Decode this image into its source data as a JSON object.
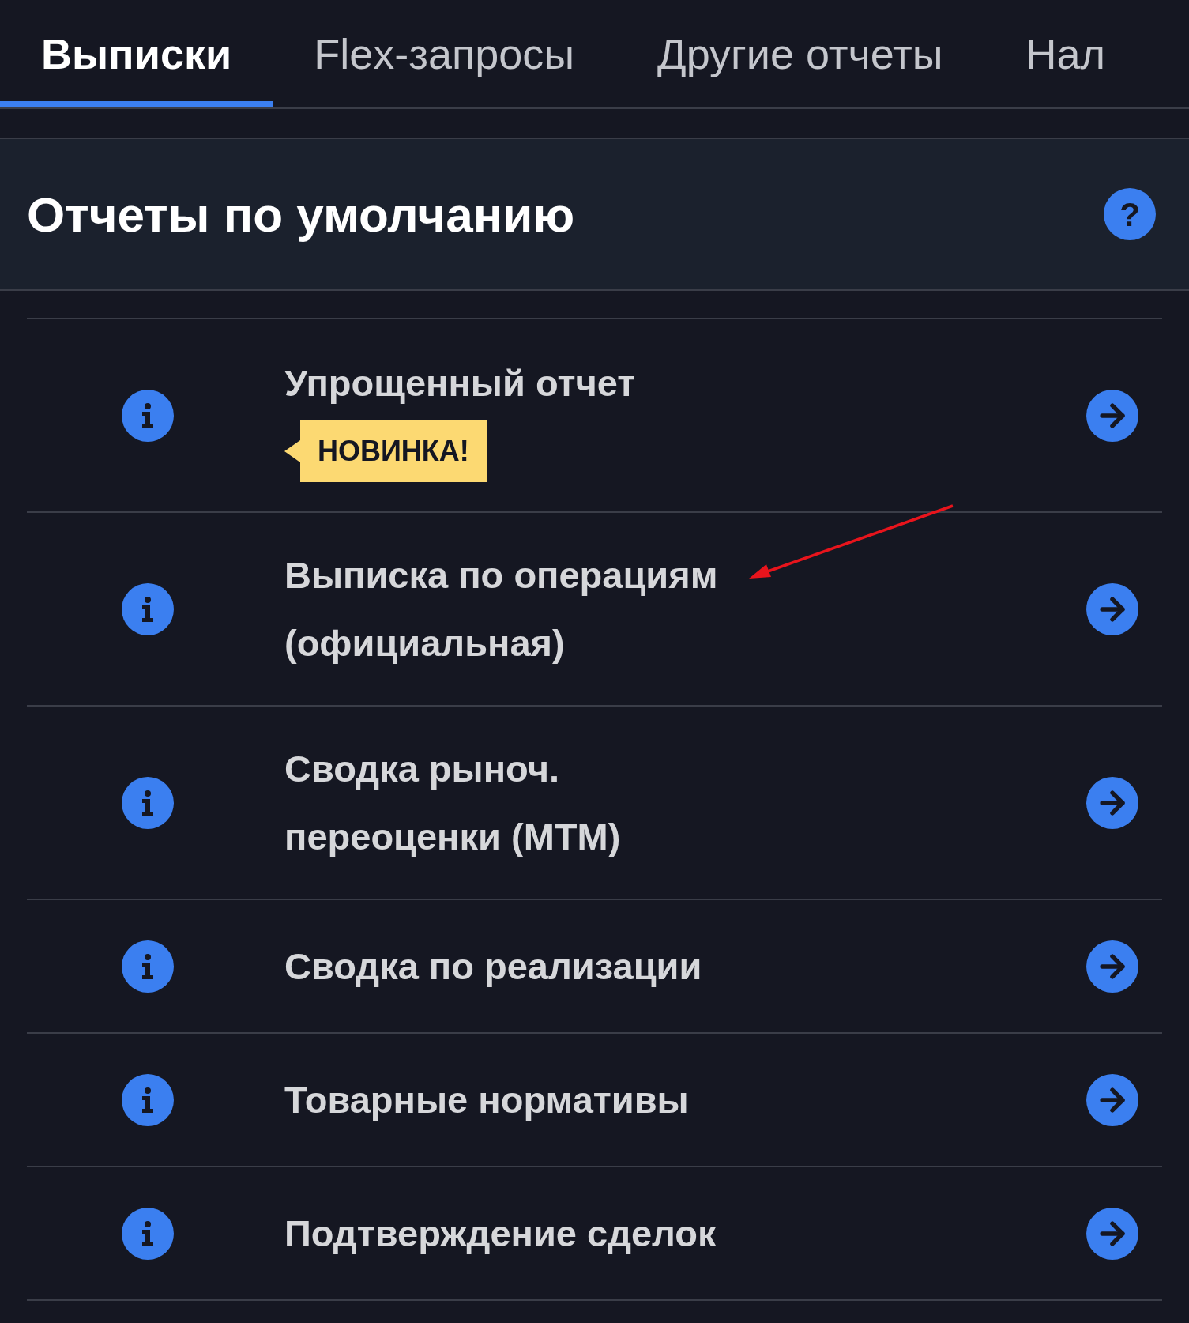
{
  "tabs": [
    {
      "label": "Выписки",
      "selected": true
    },
    {
      "label": "Flex-запросы",
      "selected": false
    },
    {
      "label": "Другие отчеты",
      "selected": false
    },
    {
      "label": "Нал",
      "selected": false
    }
  ],
  "section": {
    "title": "Отчеты по умолчанию",
    "help": "?"
  },
  "reports": [
    {
      "title": "Упрощенный отчет",
      "badge": "НОВИНКА!"
    },
    {
      "title": "Выписка по операциям\n(официальная)"
    },
    {
      "title": "Сводка рыноч.\nпереоценки (MTM)"
    },
    {
      "title": "Сводка по реализации"
    },
    {
      "title": "Товарные нормативы"
    },
    {
      "title": "Подтверждение сделок"
    }
  ]
}
